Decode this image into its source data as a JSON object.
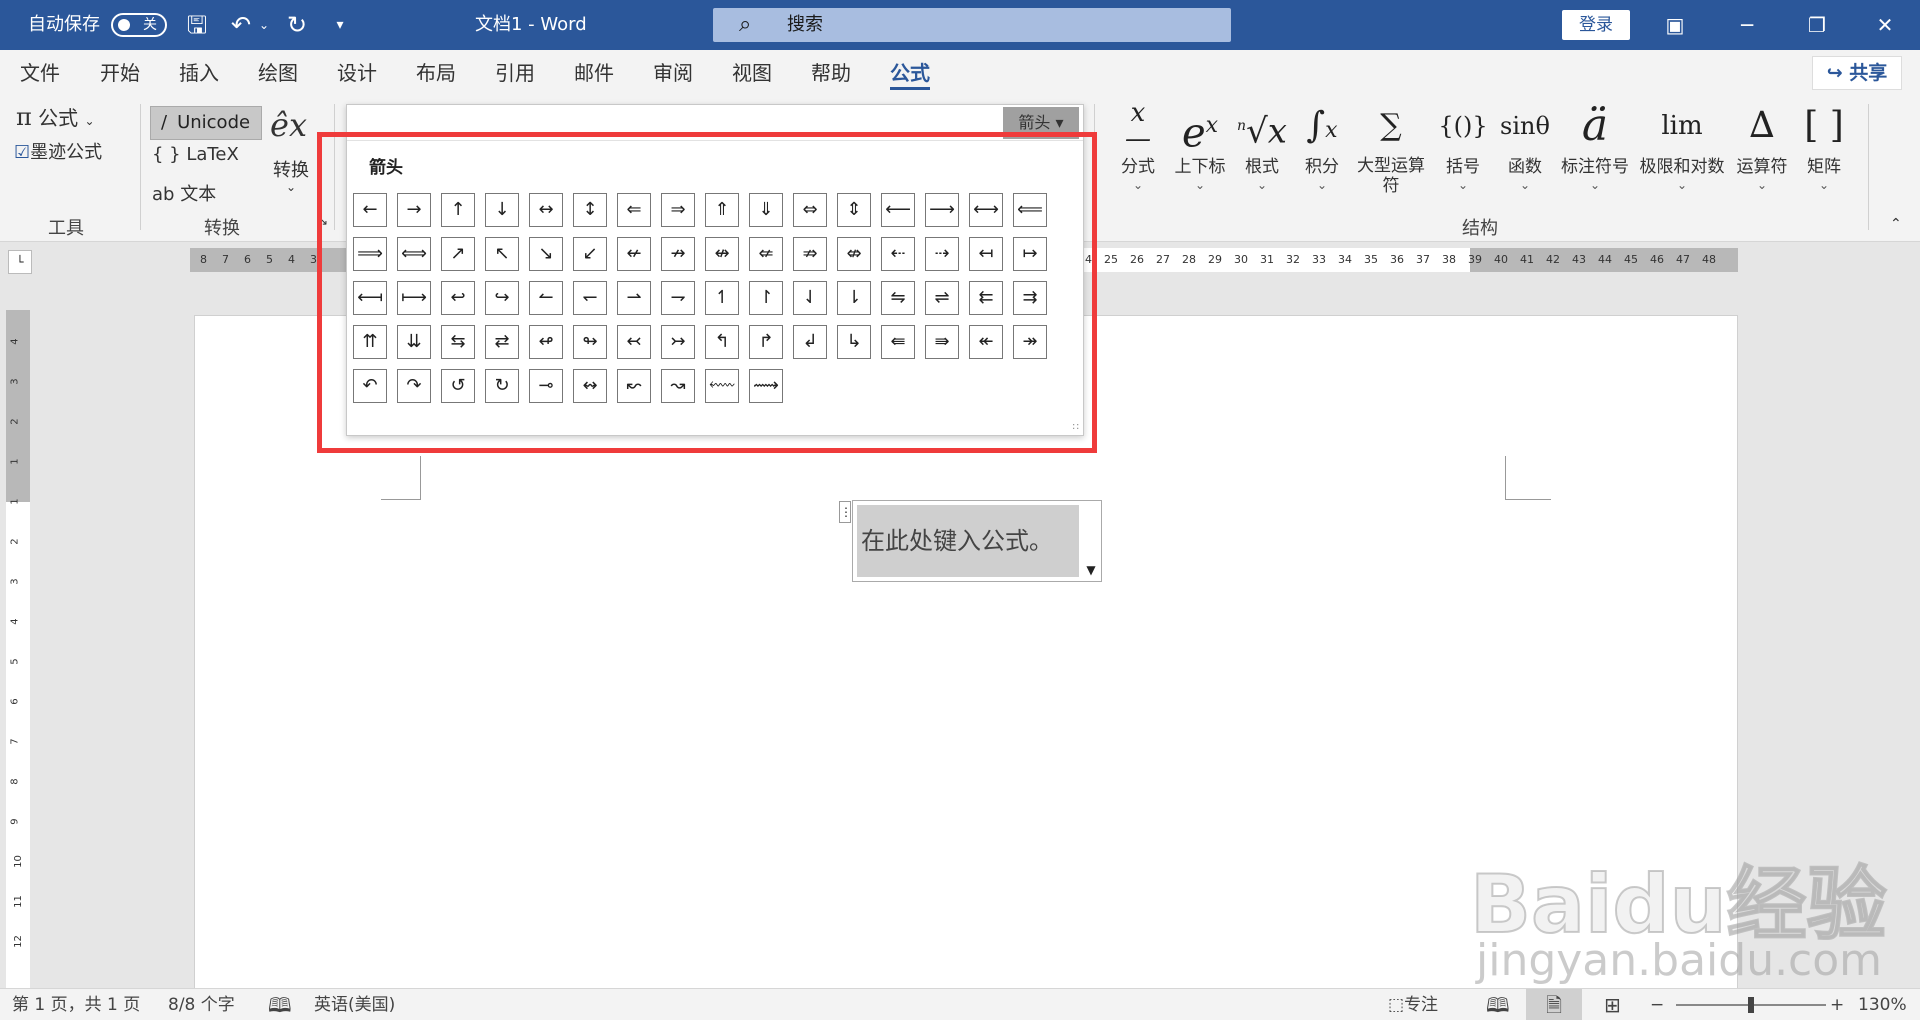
{
  "titlebar": {
    "autosave_label": "自动保存",
    "autosave_state": "关",
    "doc_title": "文档1  -  Word",
    "search_placeholder": "搜索",
    "login_label": "登录"
  },
  "menu_tabs": [
    "文件",
    "开始",
    "插入",
    "绘图",
    "设计",
    "布局",
    "引用",
    "邮件",
    "审阅",
    "视图",
    "帮助",
    "公式"
  ],
  "active_tab": "公式",
  "share_label": "共享",
  "ribbon": {
    "tools": {
      "formula": "公式",
      "ink_formula": "墨迹公式",
      "group_label": "工具"
    },
    "convert": {
      "unicode": "Unicode",
      "latex": "LaTeX",
      "text": "文本",
      "convert_btn": "转换",
      "group_label": "转换"
    },
    "structures": {
      "group_label": "结构",
      "items": [
        {
          "name": "fraction",
          "label": "分式"
        },
        {
          "name": "script",
          "label": "上下标"
        },
        {
          "name": "radical",
          "label": "根式"
        },
        {
          "name": "integral",
          "label": "积分"
        },
        {
          "name": "large-operator",
          "label": "大型运算符"
        },
        {
          "name": "bracket",
          "label": "括号"
        },
        {
          "name": "function",
          "label": "函数"
        },
        {
          "name": "accent",
          "label": "标注符号"
        },
        {
          "name": "limit-log",
          "label": "极限和对数"
        },
        {
          "name": "operator",
          "label": "运算符"
        },
        {
          "name": "matrix",
          "label": "矩阵"
        }
      ]
    }
  },
  "gallery": {
    "dropdown_label": "箭头",
    "title": "箭头",
    "symbols": [
      "←",
      "→",
      "↑",
      "↓",
      "↔",
      "↕",
      "⇐",
      "⇒",
      "⇑",
      "⇓",
      "⇔",
      "⇕",
      "⟵",
      "⟶",
      "⟷",
      "⟸",
      "⟹",
      "⟺",
      "↗",
      "↖",
      "↘",
      "↙",
      "↚",
      "↛",
      "↮",
      "⇍",
      "⇏",
      "⇎",
      "⇠",
      "⇢",
      "↤",
      "↦",
      "⟻",
      "⟼",
      "↩",
      "↪",
      "↼",
      "↽",
      "⇀",
      "⇁",
      "↿",
      "↾",
      "⇃",
      "⇂",
      "⇋",
      "⇌",
      "⇇",
      "⇉",
      "⇈",
      "⇊",
      "⇆",
      "⇄",
      "↫",
      "↬",
      "↢",
      "↣",
      "↰",
      "↱",
      "↲",
      "↳",
      "⇚",
      "⇛",
      "↞",
      "↠",
      "↶",
      "↷",
      "↺",
      "↻",
      "⊸",
      "↭",
      "↜",
      "↝",
      "⬳",
      "⟿"
    ]
  },
  "document": {
    "equation_placeholder": "在此处键入公式。"
  },
  "watermark": {
    "line1": "Baidu经验",
    "line2": "jingyan.baidu.com"
  },
  "ruler": {
    "h_left": [
      "8",
      "7",
      "6",
      "5",
      "4",
      "3"
    ],
    "h_right": [
      "24",
      "25",
      "26",
      "27",
      "28",
      "29",
      "30",
      "31",
      "32",
      "33",
      "34",
      "35",
      "36",
      "37",
      "38",
      "39",
      "40",
      "41",
      "42",
      "43",
      "44",
      "45",
      "46",
      "47",
      "48"
    ],
    "v": [
      "4",
      "3",
      "2",
      "1",
      "1",
      "2",
      "3",
      "4",
      "5",
      "6",
      "7",
      "8",
      "9",
      "10",
      "11",
      "12"
    ]
  },
  "statusbar": {
    "page": "第 1 页，共 1 页",
    "words": "8/8 个字",
    "language": "英语(美国)",
    "focus": "专注",
    "zoom": "130%"
  }
}
